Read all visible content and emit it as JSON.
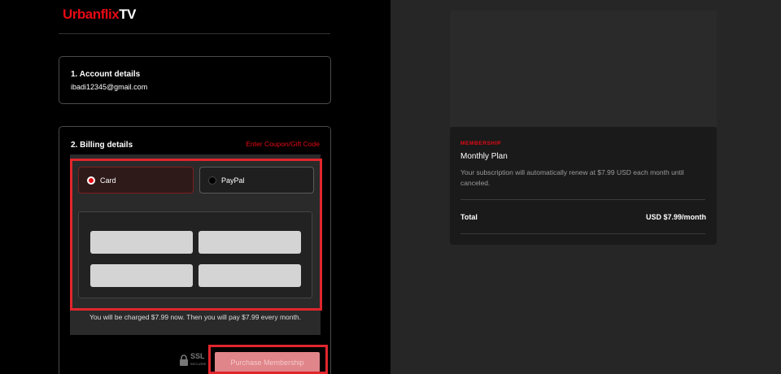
{
  "brand": {
    "name": "Urbanflix",
    "suffix": "TV"
  },
  "account": {
    "title": "1. Account details",
    "email": "ibadi12345@gmail.com"
  },
  "billing": {
    "title": "2. Billing details",
    "coupon_link": "Enter Coupon/Gift Code",
    "methods": [
      {
        "label": "Card",
        "selected": true
      },
      {
        "label": "PayPal",
        "selected": false
      }
    ],
    "charge_note": "You will be charged $7.99 now. Then you will pay $7.99 every month.",
    "ssl_label": "SSL",
    "ssl_sub": "SECURE",
    "purchase_button": "Purchase Membership"
  },
  "summary": {
    "eyebrow": "MEMBERSHIP",
    "plan": "Monthly Plan",
    "renew_text": "Your subscription will automatically renew at $7.99 USD each month until canceled.",
    "total_label": "Total",
    "total_value": "USD $7.99/month"
  },
  "colors": {
    "accent": "#e50914",
    "highlight": "#e0262d",
    "button": "#e08589"
  },
  "icons": {
    "radio_selected": "radio-selected-icon",
    "radio_unselected": "radio-unselected-icon",
    "lock": "lock-icon"
  }
}
